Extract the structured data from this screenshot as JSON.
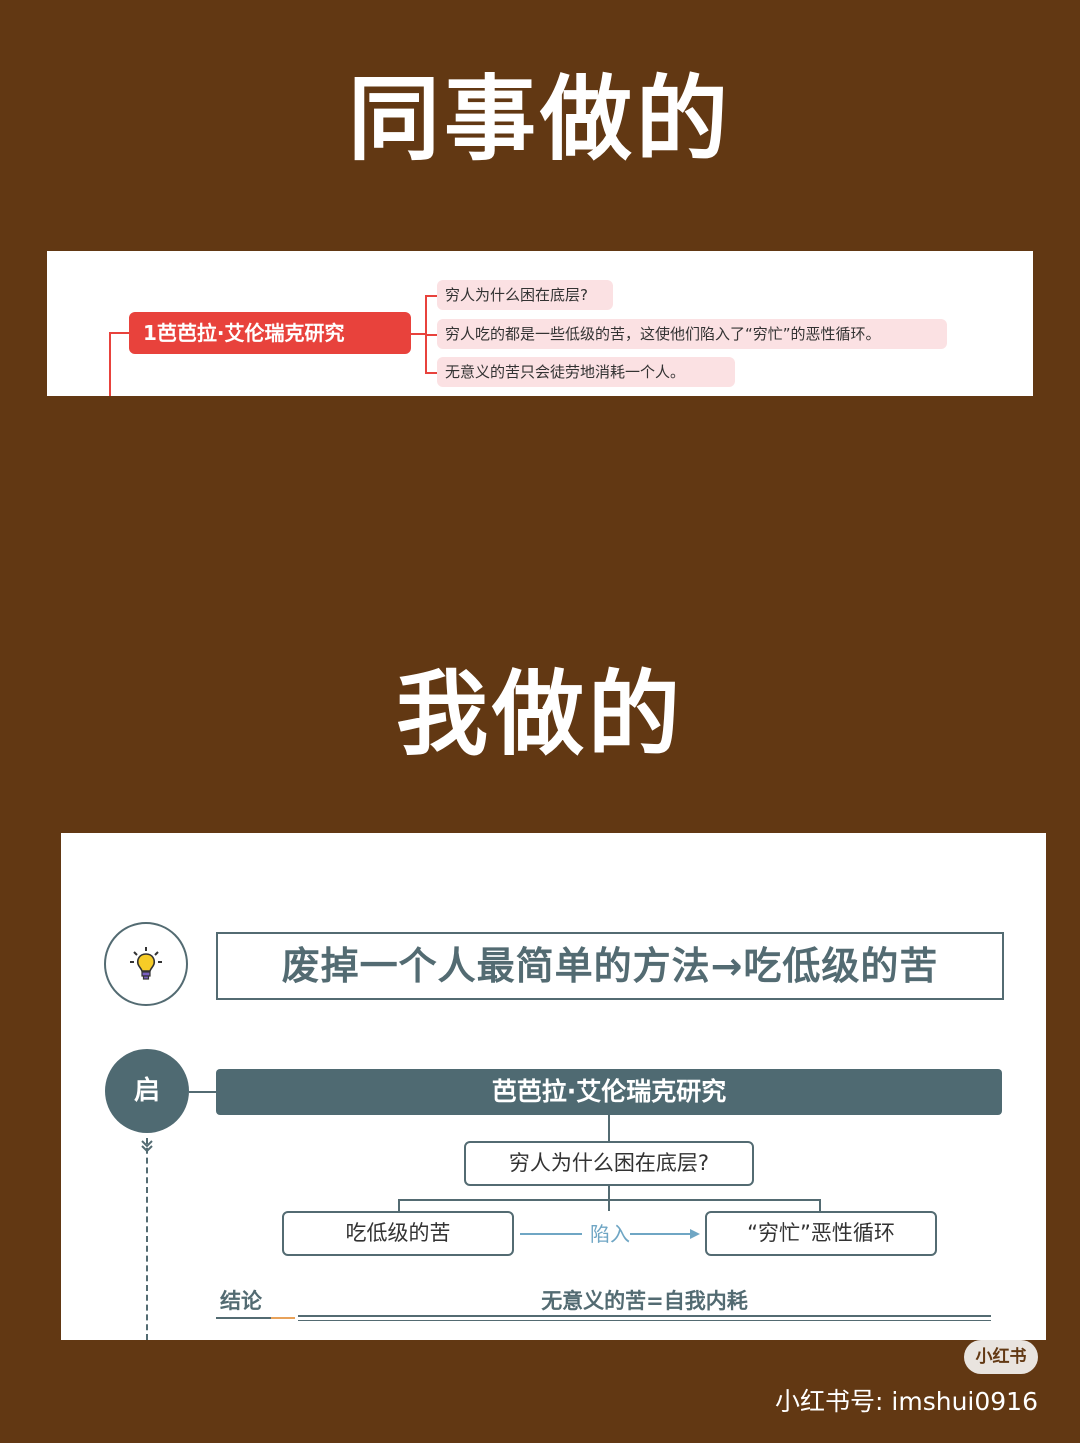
{
  "headings": {
    "colleague": "同事做的",
    "mine": "我做的"
  },
  "colleague_map": {
    "root": "1芭芭拉·艾伦瑞克研究",
    "leaves": [
      "穷人为什么困在底层?",
      "穷人吃的都是一些低级的苦，这使他们陷入了“穷忙”的恶性循环。",
      "无意义的苦只会徒劳地消耗一个人。"
    ],
    "accent_color": "#e8423c",
    "leaf_color": "#fbe1e3"
  },
  "my_map": {
    "icon": "lightbulb-icon",
    "title": "废掉一个人最简单的方法→吃低级的苦",
    "badge": "启",
    "study": "芭芭拉·艾伦瑞克研究",
    "question": "穷人为什么困在底层?",
    "left_node": "吃低级的苦",
    "arrow_label": "陷入",
    "right_node": "“穷忙”恶性循环",
    "conclusion_label": "结论",
    "conclusion_text": "无意义的苦=自我内耗",
    "main_color": "#4f6a72",
    "arrow_color": "#6fa6c4"
  },
  "watermark": {
    "badge": "小红书",
    "text": "小红书号: imshui0916"
  }
}
